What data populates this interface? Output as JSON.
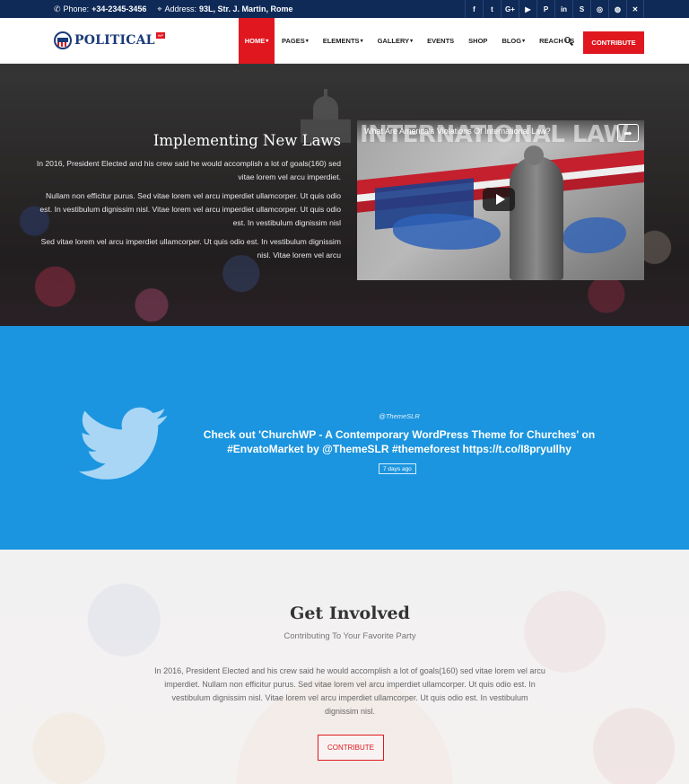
{
  "topbar": {
    "phone_label": "Phone:",
    "phone_value": "+34-2345-3456",
    "address_label": "Address:",
    "address_value": "93L, Str. J. Martin, Rome",
    "socials": [
      "f",
      "t",
      "G+",
      "▶",
      "P",
      "in",
      "S",
      "◎",
      "◍",
      "✕"
    ]
  },
  "header": {
    "logo_text": "POLITICAL",
    "logo_badge": "WP",
    "nav": [
      {
        "label": "HOME",
        "caret": "▾"
      },
      {
        "label": "PAGES",
        "caret": "▾"
      },
      {
        "label": "ELEMENTS",
        "caret": "▾"
      },
      {
        "label": "GALLERY",
        "caret": "▾"
      },
      {
        "label": "EVENTS",
        "caret": ""
      },
      {
        "label": "SHOP",
        "caret": ""
      },
      {
        "label": "BLOG",
        "caret": "▾"
      },
      {
        "label": "REACH US",
        "caret": ""
      }
    ],
    "cta": "CONTRIBUTE"
  },
  "hero": {
    "title": "Implementing New Laws",
    "paragraphs": [
      "In 2016, President Elected and his crew said he would accomplish a lot of goals(160) sed vitae lorem vel arcu imperdiet.",
      "Nullam non efficitur purus. Sed vitae lorem vel arcu imperdiet ullamcorper. Ut quis odio est. In vestibulum dignissim nisl. Vitae lorem vel arcu imperdiet ullamcorper. Ut quis odio est. In vestibulum dignissim nisl",
      "Sed vitae lorem vel arcu imperdiet ullamcorper. Ut quis odio est. In vestibulum dignissim nisl. Vitae lorem vel arcu"
    ],
    "video": {
      "title": "What Are America's Violations Of International Law?",
      "overlay_text": "INTERNATIONAL LAW"
    }
  },
  "twitter": {
    "user": "@ThemeSLR",
    "text": "Check out 'ChurchWP - A Contemporary WordPress Theme for Churches' on #EnvatoMarket by @ThemeSLR #themeforest https://t.co/I8pryuIlhy",
    "date": "7 days ago"
  },
  "involved": {
    "title": "Get Involved",
    "subtitle": "Contributing To Your Favorite Party",
    "body": "In 2016, President Elected and his crew said he would accomplish a lot of goals(160) sed vitae lorem vel arcu imperdiet. Nullam non efficitur purus. Sed vitae lorem vel arcu imperdiet ullamcorper. Ut quis odio est. In vestibulum dignissim nisl. Vitae lorem vel arcu imperdiet ullamcorper. Ut quis odio est. In vestibulum dignissim nisl.",
    "button": "CONTRIBUTE"
  },
  "colors": {
    "topbar_bg": "#0f2a57",
    "accent_red": "#e0171f",
    "twitter_blue": "#1b95df"
  }
}
